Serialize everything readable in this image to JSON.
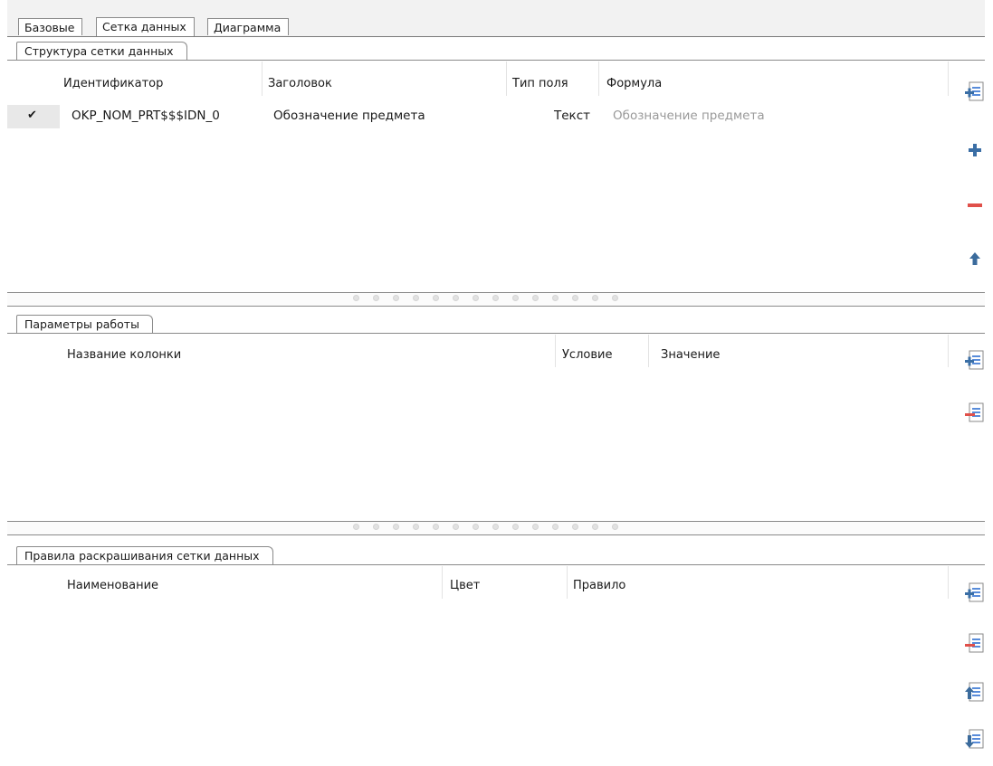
{
  "tabs": [
    {
      "label": "Базовые"
    },
    {
      "label": "Сетка данных"
    },
    {
      "label": "Диаграмма"
    }
  ],
  "grid_structure": {
    "title": "Структура сетки данных",
    "columns": [
      "Идентификатор",
      "Заголовок",
      "Тип поля",
      "Формула"
    ],
    "rows": [
      {
        "check": "✔",
        "id": "OKP_NOM_PRT$$$IDN_0",
        "caption": "Обозначение предмета",
        "type": "Текст",
        "formula": "Обозначение предмета"
      }
    ],
    "buttons": [
      "add-row-icon",
      "plus-icon",
      "minus-icon",
      "arrow-up-icon"
    ]
  },
  "work_params": {
    "title": "Параметры работы",
    "columns": [
      "Название колонки",
      "Условие",
      "Значение"
    ],
    "buttons": [
      "add-row-icon",
      "remove-row-icon"
    ]
  },
  "coloring_rules": {
    "title": "Правила раскрашивания сетки данных",
    "columns": [
      "Наименование",
      "Цвет",
      "Правило"
    ],
    "buttons": [
      "add-row-icon",
      "remove-row-icon",
      "move-up-icon",
      "move-down-icon"
    ]
  },
  "colors": {
    "accent_blue": "#2f6fd1",
    "plus_blue": "#3a6ea5",
    "minus_red": "#e0504a",
    "arrow_blue": "#3b6b9c"
  }
}
